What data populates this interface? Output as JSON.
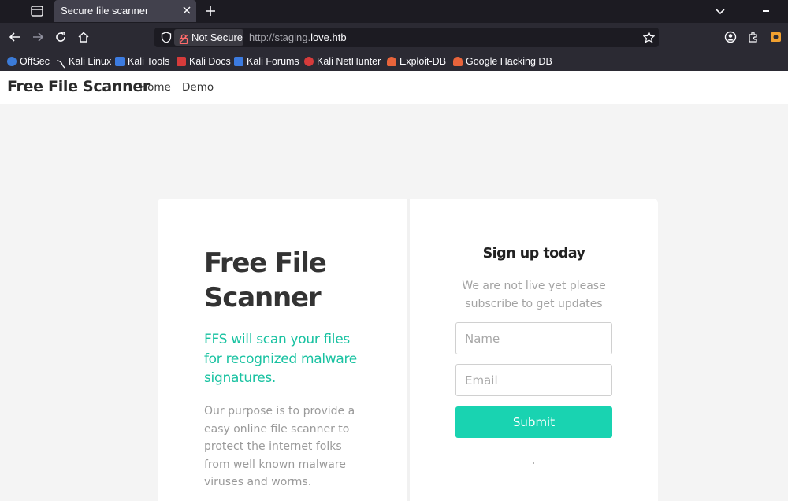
{
  "browser": {
    "tab_title": "Secure file scanner",
    "security_label": "Not Secure",
    "url_prefix": "http://staging.",
    "url_host": "love.htb"
  },
  "bookmarks": [
    {
      "label": "OffSec",
      "icon": "offsec-icon",
      "color": "#3b7bd8"
    },
    {
      "label": "Kali Linux",
      "icon": "kali-dragon-icon",
      "color": "#2b2a33"
    },
    {
      "label": "Kali Tools",
      "icon": "kali-tools-icon",
      "color": "#3c7be0"
    },
    {
      "label": "Kali Docs",
      "icon": "kali-docs-icon",
      "color": "#d63b3b"
    },
    {
      "label": "Kali Forums",
      "icon": "kali-forums-icon",
      "color": "#3c7be0"
    },
    {
      "label": "Kali NetHunter",
      "icon": "nethunter-icon",
      "color": "#d63b3b"
    },
    {
      "label": "Exploit-DB",
      "icon": "exploit-db-icon",
      "color": "#e8643b"
    },
    {
      "label": "Google Hacking DB",
      "icon": "ghdb-icon",
      "color": "#e8643b"
    }
  ],
  "site": {
    "brand": "Free File Scanner",
    "nav": [
      "Home",
      "Demo"
    ]
  },
  "hero": {
    "title": "Free File Scanner",
    "subtitle": "FFS will scan your files for recognized malware signatures.",
    "body": "Our purpose is to provide a easy online file scanner to protect the internet folks from well known malware viruses and worms."
  },
  "signup": {
    "title": "Sign up today",
    "description": "We are not live yet please subscribe to get updates",
    "name_placeholder": "Name",
    "email_placeholder": "Email",
    "submit_label": "Submit"
  },
  "colors": {
    "accent": "#19d3b1",
    "accent_text": "#19c2a1"
  }
}
